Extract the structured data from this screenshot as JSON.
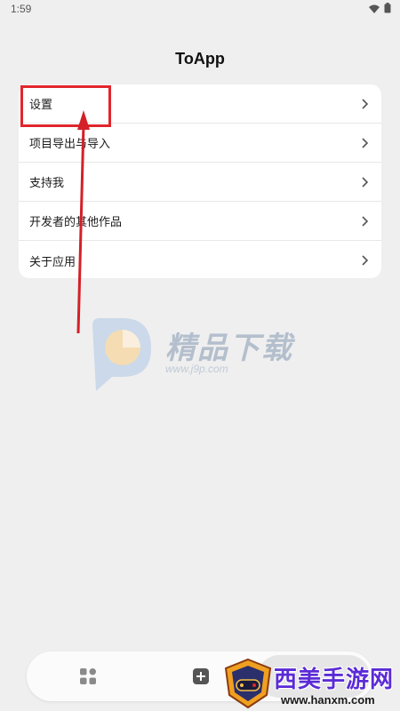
{
  "status_bar": {
    "time": "1:59"
  },
  "app": {
    "title": "ToApp"
  },
  "menu": {
    "items": [
      {
        "label": "设置"
      },
      {
        "label": "项目导出与导入"
      },
      {
        "label": "支持我"
      },
      {
        "label": "开发者的其他作品"
      },
      {
        "label": "关于应用"
      }
    ]
  },
  "watermark": {
    "brand": "精品下载",
    "url": "www.j9p.com"
  },
  "site_logo": {
    "name": "西美手游网",
    "url": "www.hanxm.com"
  },
  "colors": {
    "background": "#efefef",
    "card": "#ffffff",
    "highlight": "#e1262c",
    "site_name": "#5b2bd6"
  },
  "icons": [
    "wifi-icon",
    "battery-icon",
    "chevron-right-icon",
    "grid-icon",
    "add-icon"
  ]
}
